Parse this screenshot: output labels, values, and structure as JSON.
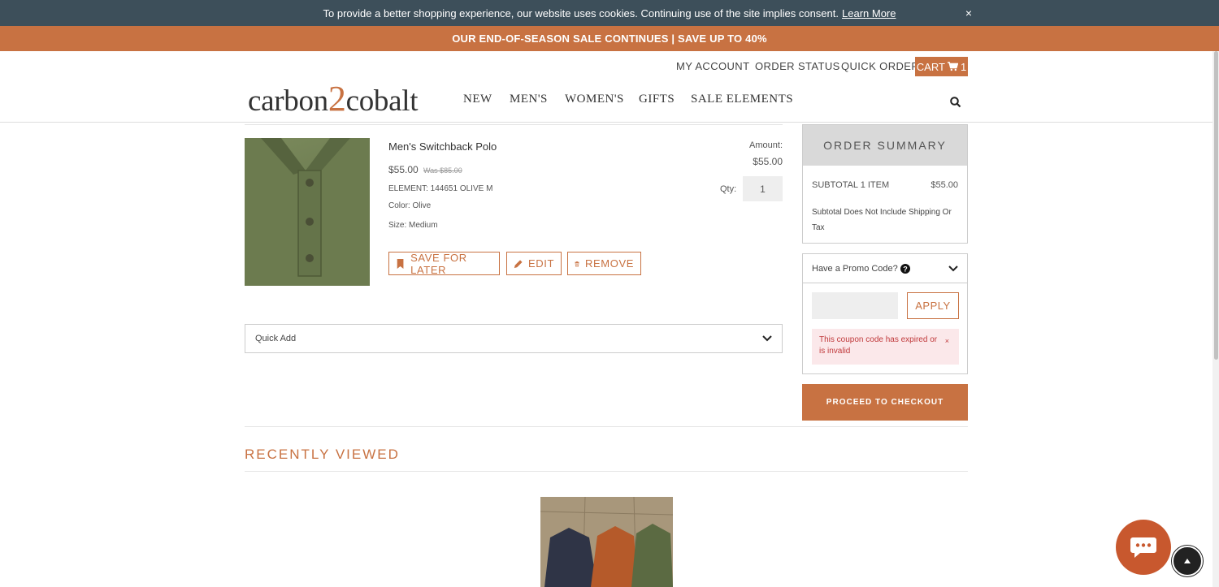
{
  "cookie_bar": {
    "message": "To provide a better shopping experience, our website uses cookies. Continuing use of the site implies consent.",
    "link": "Learn More",
    "close": "×"
  },
  "promo_banner": "OUR END-OF-SEASON SALE CONTINUES | SAVE UP TO 40%",
  "utility_nav": {
    "my_account": "MY ACCOUNT",
    "order_status": "ORDER STATUS",
    "quick_order": "QUICK ORDER",
    "cart_label": "CART",
    "cart_count": "1"
  },
  "logo": {
    "part1": "carbon",
    "part2": "2",
    "part3": "cobalt"
  },
  "main_nav": [
    "NEW",
    "MEN'S",
    "WOMEN'S",
    "GIFTS",
    "SALE ELEMENTS"
  ],
  "cart_item": {
    "name": "Men's Switchback Polo",
    "price": "$55.00",
    "was_price": "Was $85.00",
    "element": "ELEMENT: 144651 OLIVE M",
    "color": "Color: Olive",
    "size": "Size: Medium",
    "amount_label": "Amount:",
    "amount": "$55.00",
    "qty_label": "Qty:",
    "qty": "1",
    "actions": {
      "save_for_later": "SAVE FOR LATER",
      "edit": "EDIT",
      "remove": "REMOVE"
    }
  },
  "quick_add": "Quick Add",
  "order_summary": {
    "title": "ORDER SUMMARY",
    "subtotal_label": "SUBTOTAL 1 ITEM",
    "subtotal_value": "$55.00",
    "note": "Subtotal Does Not Include Shipping Or Tax"
  },
  "promo_code": {
    "label": "Have a Promo Code?",
    "input_value": "",
    "apply": "APPLY",
    "error": "This coupon code has expired or is invalid",
    "error_close": "×"
  },
  "checkout_button": "PROCEED TO CHECKOUT",
  "recently_viewed": {
    "title": "RECENTLY VIEWED"
  },
  "colors": {
    "accent": "#c87242",
    "cookie_bg": "#3d4f5a",
    "error_bg": "#fbe8ea",
    "error_text": "#c0393b"
  },
  "icons": [
    "close-icon",
    "cart-icon",
    "search-icon",
    "bookmark-icon",
    "pencil-icon",
    "trash-icon",
    "chevron-down-icon",
    "question-icon",
    "chat-icon",
    "arrow-up-icon"
  ]
}
